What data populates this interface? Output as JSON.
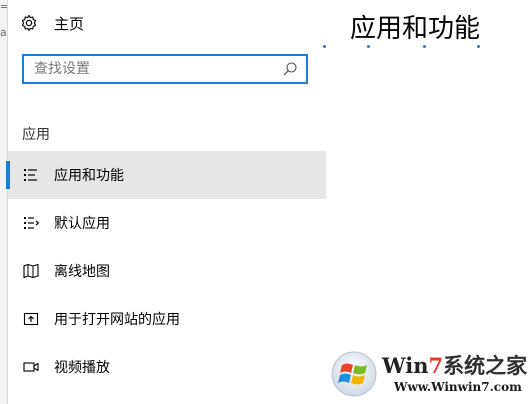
{
  "sidebar": {
    "home_label": "主页",
    "search": {
      "placeholder": "查找设置",
      "value": ""
    },
    "section_title": "应用",
    "items": [
      {
        "label": "应用和功能",
        "icon": "apps-features-icon",
        "active": true
      },
      {
        "label": "默认应用",
        "icon": "default-apps-icon",
        "active": false
      },
      {
        "label": "离线地图",
        "icon": "offline-maps-icon",
        "active": false
      },
      {
        "label": "用于打开网站的应用",
        "icon": "apps-for-websites-icon",
        "active": false
      },
      {
        "label": "视频播放",
        "icon": "video-playback-icon",
        "active": false
      }
    ]
  },
  "main": {
    "title": "应用和功能"
  },
  "watermark": {
    "part1": "Win",
    "part2": "7",
    "part3": "系统之家",
    "url": "Www.Winwin7.com"
  },
  "colors": {
    "accent": "#1a7ed9",
    "active_bg": "#e6e6e6"
  }
}
